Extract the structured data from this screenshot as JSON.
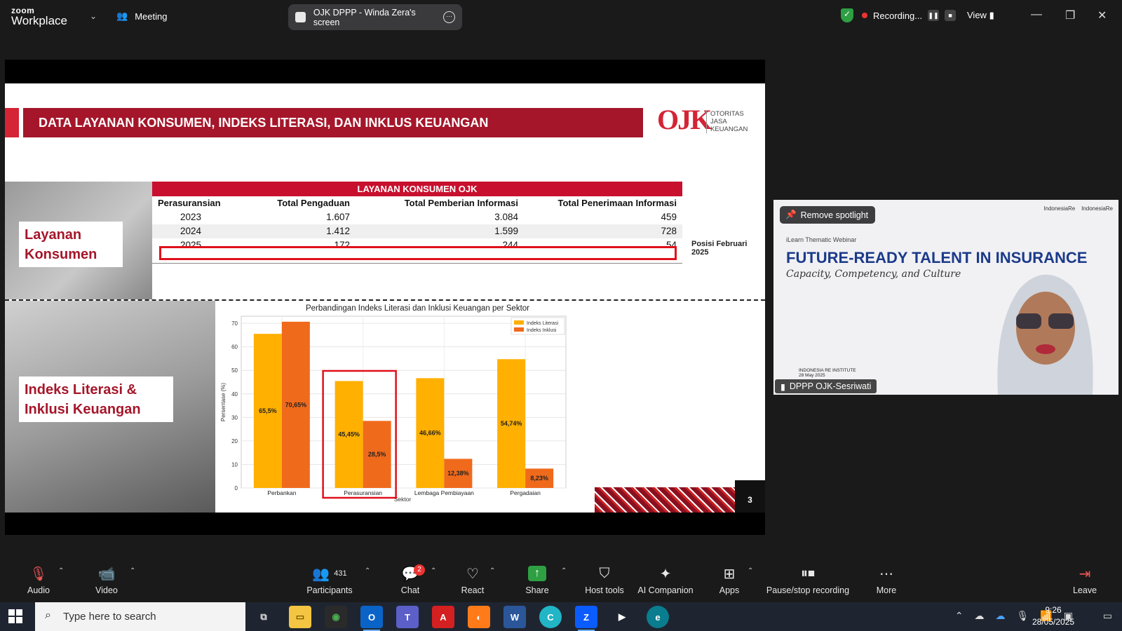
{
  "app": {
    "logo_top": "zoom",
    "logo_bottom": "Workplace",
    "meeting_label": "Meeting",
    "screen_share_label": "OJK DPPP - Winda Zera's screen",
    "recording_label": "Recording...",
    "view_label": "View"
  },
  "slide": {
    "title": "DATA LAYANAN KONSUMEN, INDEKS LITERASI, DAN INKLUS KEUANGAN",
    "ojk_mark": "OJK",
    "ojk_text": [
      "OTORITAS",
      "JASA",
      "KEUANGAN"
    ],
    "layanan_label": [
      "Layanan",
      "Konsumen"
    ],
    "indeks_label": [
      "Indeks Literasi &",
      "Inklusi Keuangan"
    ],
    "table": {
      "title": "LAYANAN KONSUMEN OJK",
      "headers": [
        "Perasuransian",
        "Total Pengaduan",
        "Total Pemberian Informasi",
        "Total Penerimaan Informasi"
      ],
      "rows": [
        [
          "2023",
          "1.607",
          "3.084",
          "459"
        ],
        [
          "2024",
          "1.412",
          "1.599",
          "728"
        ],
        [
          "2025",
          "172",
          "244",
          "54"
        ]
      ]
    },
    "posisi_note": "Posisi Februari 2025",
    "page_number": "3"
  },
  "chart_data": {
    "type": "bar",
    "title": "Perbandingan Indeks Literasi dan Inklusi Keuangan per Sektor",
    "xlabel": "Sektor",
    "ylabel": "Persentase (%)",
    "ylim": [
      0,
      73
    ],
    "yticks": [
      0,
      10,
      20,
      30,
      40,
      50,
      60,
      70
    ],
    "categories": [
      "Perbankan",
      "Perasuransian",
      "Lembaga Pembiayaan",
      "Pergadaian"
    ],
    "series": [
      {
        "name": "Indeks Literasi",
        "values": [
          65.5,
          45.45,
          46.66,
          54.74
        ],
        "labels": [
          "65,5%",
          "45,45%",
          "46,66%",
          "54,74%"
        ],
        "color": "#ffb000"
      },
      {
        "name": "Indeks Inklusi",
        "values": [
          70.65,
          28.5,
          12.38,
          8.23
        ],
        "labels": [
          "70,65%",
          "28,5%",
          "12,38%",
          "8,23%"
        ],
        "color": "#f06a1c"
      }
    ],
    "legend": "top-right",
    "grid": true,
    "highlight_category": "Perasuransian"
  },
  "video": {
    "remove_spotlight": "Remove spotlight",
    "ilearn": "iLearn Thematic Webinar",
    "webinar_title": "FUTURE-READY TALENT IN INSURANCE",
    "webinar_sub": "Capacity, Competency, and Culture",
    "logo_left": "IndonesiaRe",
    "logo_right": "IndonesiaRe",
    "institute": "INDONESIA RE INSTITUTE",
    "date_small": "28 May 2025",
    "participant_name": "DPPP OJK-Sesriwati"
  },
  "toolbar": {
    "audio": "Audio",
    "video": "Video",
    "participants": "Participants",
    "participants_count": "431",
    "chat": "Chat",
    "chat_badge": "2",
    "react": "React",
    "share": "Share",
    "host_tools": "Host tools",
    "ai_companion": "AI Companion",
    "apps": "Apps",
    "pause_stop": "Pause/stop recording",
    "more": "More",
    "leave": "Leave"
  },
  "taskbar": {
    "search_placeholder": "Type here to search",
    "time": "9:26",
    "date": "28/05/2025"
  },
  "colors": {
    "ojk_red": "#a5162a",
    "literasi": "#ffb000",
    "inklusi": "#f06a1c",
    "highlight": "#e0101a"
  }
}
